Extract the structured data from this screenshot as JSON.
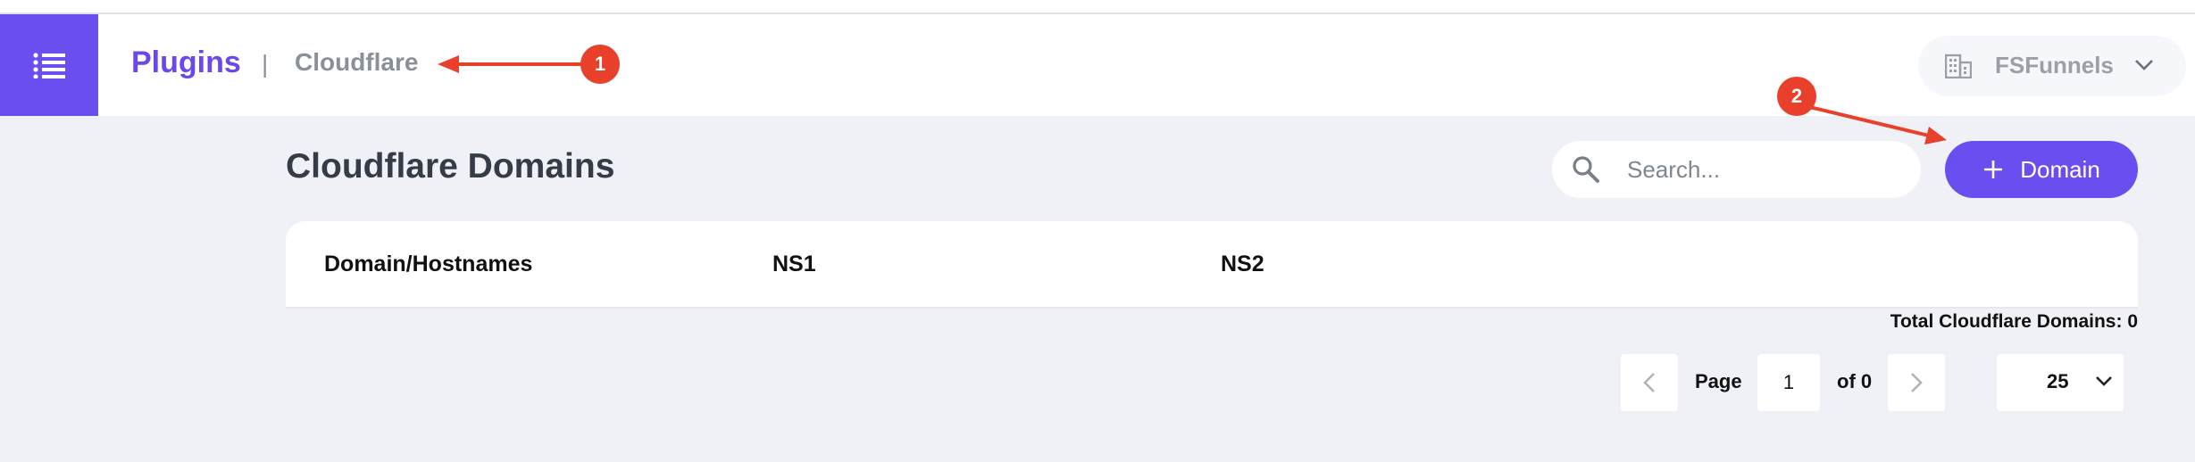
{
  "header": {
    "breadcrumb_root": "Plugins",
    "breadcrumb_separator": "|",
    "breadcrumb_current": "Cloudflare",
    "workspace_name": "FSFunnels",
    "icons": {
      "menu": "list-menu-icon",
      "workspace": "building-icon",
      "workspace_dropdown": "chevron-down-icon"
    }
  },
  "main": {
    "title": "Cloudflare Domains",
    "search": {
      "placeholder": "Search...",
      "value": "",
      "icon": "search-icon"
    },
    "add_button": {
      "icon": "plus-icon",
      "label": "Domain"
    }
  },
  "table": {
    "columns": [
      "Domain/Hostnames",
      "NS1",
      "NS2"
    ],
    "rows": []
  },
  "footer": {
    "total_text": "Total Cloudflare Domains: 0",
    "pagination": {
      "page_label": "Page",
      "current_page": "1",
      "of_label": "of 0",
      "per_page": "25"
    }
  },
  "annotations": {
    "badge1": "1",
    "badge2": "2",
    "color": "#e8402a"
  },
  "colors": {
    "accent": "#6b4ef0",
    "breadcrumb": "#6a48ec",
    "background": "#f0f1f7",
    "muted_text": "#8a9098"
  }
}
